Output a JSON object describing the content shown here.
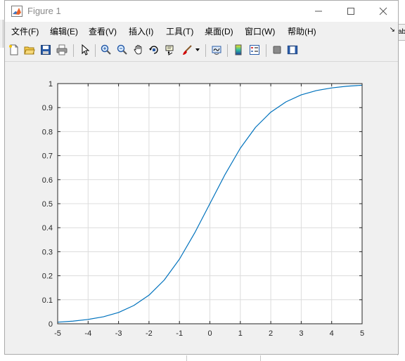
{
  "window": {
    "title": "Figure 1"
  },
  "menubar": {
    "items": [
      "文件(F)",
      "编辑(E)",
      "查看(V)",
      "插入(I)",
      "工具(T)",
      "桌面(D)",
      "窗口(W)",
      "帮助(H)"
    ]
  },
  "toolbar": {
    "buttons": [
      "new-figure-icon",
      "open-file-icon",
      "save-icon",
      "print-icon",
      "select-arrow-icon",
      "zoom-in-icon",
      "zoom-out-icon",
      "pan-hand-icon",
      "rotate-3d-icon",
      "data-cursor-icon",
      "brush-icon",
      "link-plot-icon",
      "colorbar-icon",
      "legend-icon",
      "hide-plot-tools-icon",
      "show-plot-tools-icon"
    ]
  },
  "background": {
    "right_tab_label": "ab"
  },
  "colors": {
    "line": "#0072BD",
    "grid": "#dcdcdc",
    "axes_bg": "#ffffff",
    "figure_bg": "#f0f0f0"
  },
  "chart_data": {
    "type": "line",
    "title": "",
    "xlabel": "",
    "ylabel": "",
    "xlim": [
      -5,
      5
    ],
    "ylim": [
      0,
      1
    ],
    "grid": true,
    "xticks": [
      -5,
      -4,
      -3,
      -2,
      -1,
      0,
      1,
      2,
      3,
      4,
      5
    ],
    "yticks": [
      0,
      0.1,
      0.2,
      0.3,
      0.4,
      0.5,
      0.6,
      0.7,
      0.8,
      0.9,
      1
    ],
    "series": [
      {
        "x": [
          -5,
          -4.5,
          -4,
          -3.5,
          -3,
          -2.5,
          -2,
          -1.5,
          -1,
          -0.5,
          0,
          0.5,
          1,
          1.5,
          2,
          2.5,
          3,
          3.5,
          4,
          4.5,
          5
        ],
        "y": [
          0.0067,
          0.011,
          0.018,
          0.029,
          0.047,
          0.076,
          0.119,
          0.182,
          0.269,
          0.378,
          0.5,
          0.622,
          0.731,
          0.818,
          0.881,
          0.924,
          0.953,
          0.971,
          0.982,
          0.989,
          0.993
        ]
      }
    ]
  }
}
